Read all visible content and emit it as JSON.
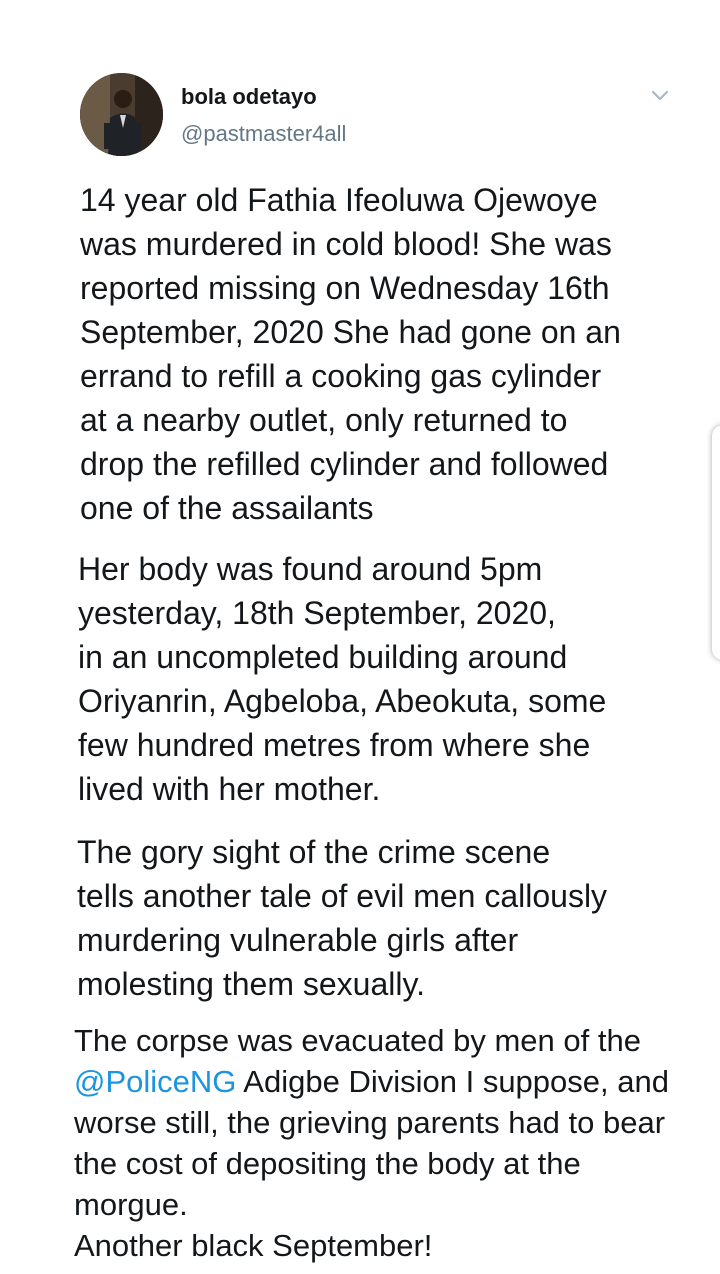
{
  "tweet": {
    "author": {
      "display_name": "bola odetayo",
      "handle": "@pastmaster4all"
    },
    "menu_icon": "chevron-down-icon",
    "paragraphs": [
      {
        "lines": [
          "14 year old Fathia Ifeoluwa Ojewoye",
          "was murdered in cold blood! She was",
          "reported missing on Wednesday 16th",
          "September, 2020 She had gone on an",
          "errand to refill a cooking gas cylinder",
          "at a nearby outlet, only returned to",
          "drop the refilled cylinder and followed",
          "one of the assailants"
        ]
      },
      {
        "lines": [
          "Her body was found around 5pm",
          "yesterday, 18th September, 2020,",
          "in an uncompleted building around",
          "Oriyanrin, Agbeloba, Abeokuta, some",
          "few hundred metres from where she",
          "lived with her mother."
        ]
      },
      {
        "lines": [
          "The gory sight of the crime scene",
          "tells another tale of evil men callously",
          "murdering vulnerable girls after",
          "molesting them sexually."
        ]
      },
      {
        "line1": "The corpse was evacuated by men of the",
        "mention": "@PoliceNG",
        "line2_rest": " Adigbe Division I suppose, and",
        "line3": "worse still, the grieving parents had to bear",
        "line4": "the cost of depositing the body at the",
        "line5": "morgue.",
        "line6": "Another black September!"
      }
    ]
  },
  "colors": {
    "text": "#14171a",
    "secondary": "#657786",
    "link": "#1b95e0"
  }
}
